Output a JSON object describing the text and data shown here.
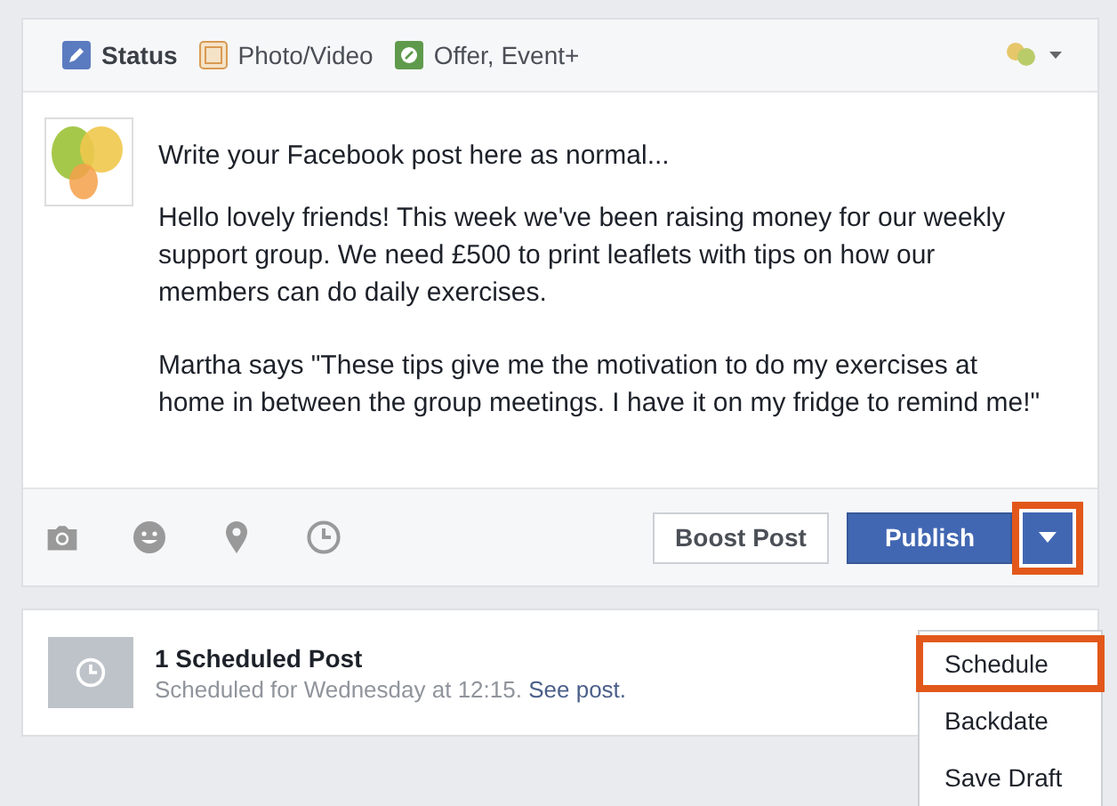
{
  "tabs": [
    {
      "label": "Status",
      "kind": "pencil",
      "selected": true
    },
    {
      "label": "Photo/Video",
      "kind": "photo",
      "selected": false
    },
    {
      "label": "Offer, Event+",
      "kind": "offer",
      "selected": false
    }
  ],
  "composer": {
    "paragraphs": [
      "Write your Facebook post here as normal...",
      "Hello lovely friends! This week we've been raising money for our weekly support group. We need £500 to print leaflets with tips on how our members can do daily exercises.",
      "Martha says \"These tips give me the motivation to do my exercises at home in between the group meetings. I have it on my fridge to remind me!\""
    ]
  },
  "footer": {
    "tools": [
      {
        "kind": "camera"
      },
      {
        "kind": "smiley"
      },
      {
        "kind": "pin"
      },
      {
        "kind": "clock"
      }
    ],
    "boost_button": "Boost Post",
    "publish_button": "Publish",
    "dropdown_highlighted": true
  },
  "menu": [
    {
      "label": "Schedule",
      "highlighted": true
    },
    {
      "label": "Backdate",
      "highlighted": false
    },
    {
      "label": "Save Draft",
      "highlighted": false
    }
  ],
  "scheduled": {
    "title": "1 Scheduled Post",
    "text": "Scheduled for Wednesday at 12:15.",
    "link": "See post."
  }
}
